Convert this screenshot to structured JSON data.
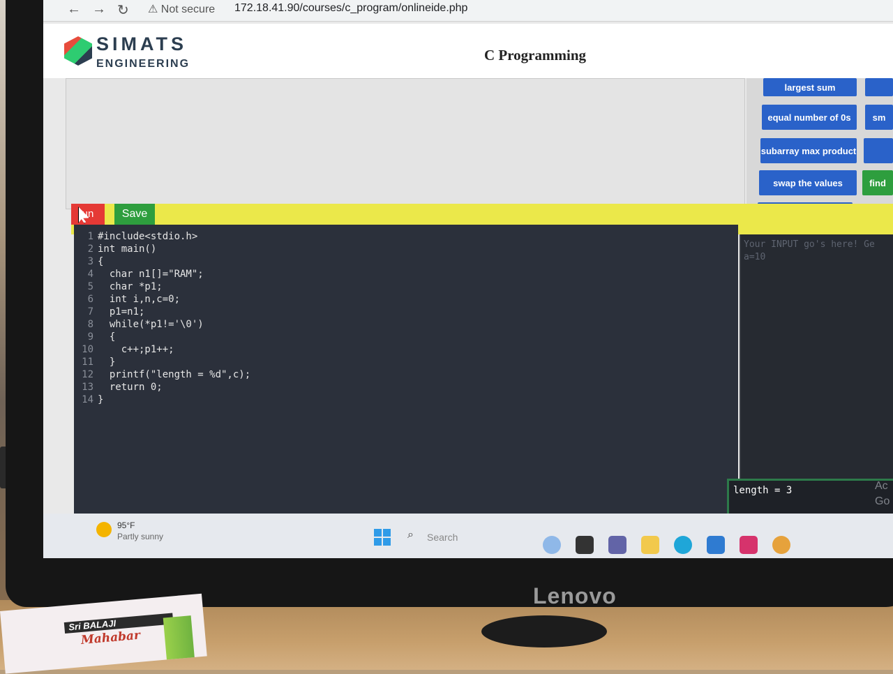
{
  "browser": {
    "security_label": "Not secure",
    "url": "172.18.41.90/courses/c_program/onlineide.php"
  },
  "header": {
    "logo_text": "SIMATS",
    "logo_sub": "ENGINEERING",
    "page_title": "C Programming"
  },
  "problems": [
    {
      "label": "largest sum",
      "color": "#2a62c9"
    },
    {
      "label": "equal number of 0s",
      "color": "#2a62c9"
    },
    {
      "label": "subarray max product",
      "color": "#2a62c9"
    },
    {
      "label": "swap the values",
      "color": "#2a62c9"
    },
    {
      "label": "",
      "color": "#2a62c9"
    },
    {
      "label": "sm",
      "color": "#2a62c9"
    },
    {
      "label": "",
      "color": "#2a62c9"
    },
    {
      "label": "find",
      "color": "#2e9e3e"
    }
  ],
  "toolbar": {
    "run_label": "un",
    "save_label": "Save"
  },
  "editor": {
    "line_numbers": [
      "1",
      "2",
      "3",
      "4",
      "5",
      "6",
      "7",
      "8",
      "9",
      "10",
      "11",
      "12",
      "13",
      "14"
    ],
    "lines": [
      "#include<stdio.h>",
      "int main()",
      "{",
      "  char n1[]=\"RAM\";",
      "  char *p1;",
      "  int i,n,c=0;",
      "  p1=n1;",
      "  while(*p1!='\\0')",
      "  {",
      "    c++;p1++;",
      "  }",
      "  printf(\"length = %d\",c);",
      "  return 0;",
      "}"
    ]
  },
  "input_panel": {
    "placeholder": "Your INPUT go's here! Ge",
    "value": "a=10"
  },
  "output_panel": {
    "text": "length = 3"
  },
  "activation_hint": [
    "Ac",
    "Go"
  ],
  "taskbar": {
    "weather_temp": "95°F",
    "weather_desc": "Partly sunny",
    "search_label": "Search",
    "apps": [
      {
        "name": "bing-icon",
        "color": "#8fb8e8"
      },
      {
        "name": "files-icon",
        "color": "#333333"
      },
      {
        "name": "chat-icon",
        "color": "#6264a7"
      },
      {
        "name": "folder-icon",
        "color": "#f2c94c"
      },
      {
        "name": "edge-icon",
        "color": "#1fa6d8"
      },
      {
        "name": "store-icon",
        "color": "#2f7bd1"
      },
      {
        "name": "instagram-icon",
        "color": "#d6336c"
      },
      {
        "name": "chrome-icon",
        "color": "#e6a23c"
      }
    ]
  },
  "monitor_brand": "Lenovo",
  "desk_paper": {
    "band_text": "Sri BALAJI",
    "script_text": "Mahabar"
  }
}
